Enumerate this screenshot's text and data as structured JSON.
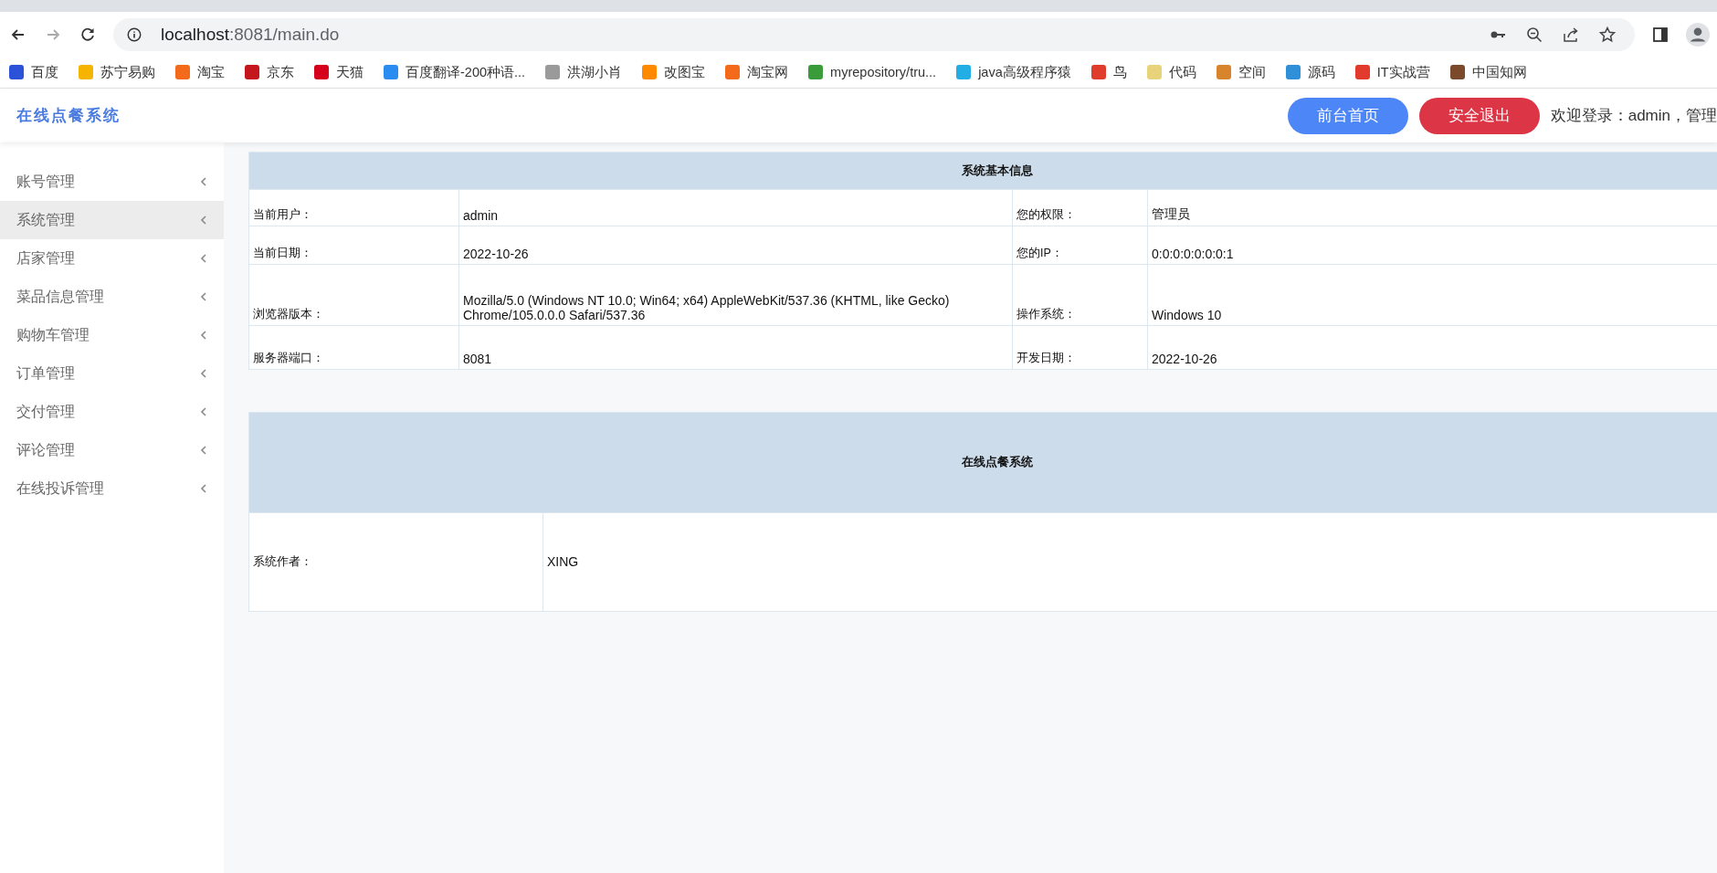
{
  "browser": {
    "url_host": "localhost",
    "url_rest": ":8081/main.do",
    "bookmarks": [
      {
        "label": "百度",
        "color": "#2b52d8"
      },
      {
        "label": "苏宁易购",
        "color": "#f5b400"
      },
      {
        "label": "淘宝",
        "color": "#f46a1b"
      },
      {
        "label": "京东",
        "color": "#c4161c"
      },
      {
        "label": "天猫",
        "color": "#d6001c"
      },
      {
        "label": "百度翻译-200种语...",
        "color": "#2a8cf0"
      },
      {
        "label": "洪湖小肖",
        "color": "#9a9a9a"
      },
      {
        "label": "改图宝",
        "color": "#ff8a00"
      },
      {
        "label": "淘宝网",
        "color": "#f46a1b"
      },
      {
        "label": "myrepository/tru...",
        "color": "#3a9b3a"
      },
      {
        "label": "java高级程序猿",
        "color": "#23ade5"
      },
      {
        "label": "鸟",
        "color": "#e03c2c"
      },
      {
        "label": "代码",
        "color": "#e8d27a"
      },
      {
        "label": "空间",
        "color": "#d8842c"
      },
      {
        "label": "源码",
        "color": "#2f8fd8"
      },
      {
        "label": "IT实战营",
        "color": "#e23b2e"
      },
      {
        "label": "中国知网",
        "color": "#7a4a2a"
      }
    ]
  },
  "header": {
    "title": "在线点餐系统",
    "buttons": [
      {
        "label": "前台首页",
        "kind": "primary"
      },
      {
        "label": "安全退出",
        "kind": "danger"
      }
    ],
    "welcome": "欢迎登录：admin，管理"
  },
  "sidebar": {
    "items": [
      {
        "label": "账号管理",
        "highlighted": false
      },
      {
        "label": "系统管理",
        "highlighted": true
      },
      {
        "label": "店家管理",
        "highlighted": false
      },
      {
        "label": "菜品信息管理",
        "highlighted": false
      },
      {
        "label": "购物车管理",
        "highlighted": false
      },
      {
        "label": "订单管理",
        "highlighted": false
      },
      {
        "label": "交付管理",
        "highlighted": false
      },
      {
        "label": "评论管理",
        "highlighted": false
      },
      {
        "label": "在线投诉管理",
        "highlighted": false
      }
    ]
  },
  "info_table": {
    "title": "系统基本信息",
    "rows": [
      {
        "label_1": "当前用户：",
        "value_1": "admin",
        "label_2": "您的权限：",
        "value_2": "管理员"
      },
      {
        "label_1": "当前日期：",
        "value_1": "2022-10-26",
        "label_2": "您的IP：",
        "value_2": "0:0:0:0:0:0:0:1"
      },
      {
        "label_1": "浏览器版本：",
        "value_1": "Mozilla/5.0 (Windows NT 10.0; Win64; x64) AppleWebKit/537.36 (KHTML, like Gecko) Chrome/105.0.0.0 Safari/537.36",
        "label_2": "操作系统：",
        "value_2": "Windows 10"
      },
      {
        "label_1": "服务器端口：",
        "value_1": "8081",
        "label_2": "开发日期：",
        "value_2": "2022-10-26"
      }
    ]
  },
  "about_table": {
    "title": "在线点餐系统",
    "rows": [
      {
        "label": "系统作者：",
        "value": "XING"
      }
    ]
  }
}
